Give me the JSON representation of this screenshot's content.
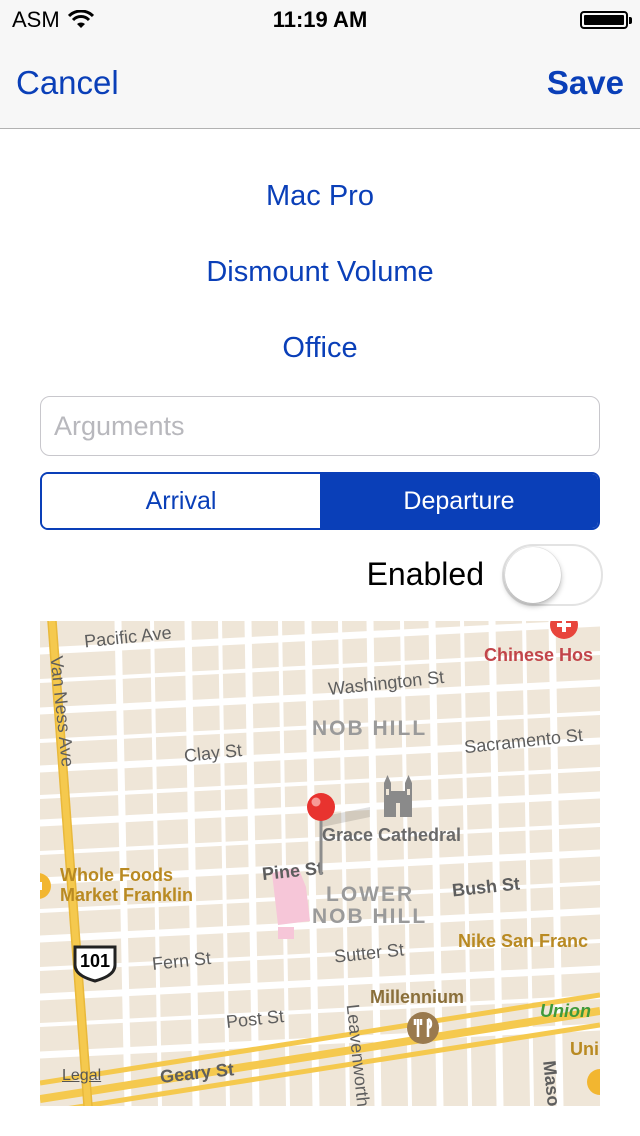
{
  "status_bar": {
    "carrier": "ASM",
    "time": "11:19 AM"
  },
  "nav": {
    "cancel_label": "Cancel",
    "save_label": "Save"
  },
  "actions": {
    "device": "Mac Pro",
    "action": "Dismount Volume",
    "location": "Office"
  },
  "arguments": {
    "value": "",
    "placeholder": "Arguments"
  },
  "trigger": {
    "options": [
      "Arrival",
      "Departure"
    ],
    "selected": "Departure"
  },
  "enabled": {
    "label": "Enabled",
    "on": false
  },
  "map": {
    "streets": [
      "Pacific Ave",
      "Van Ness Ave",
      "Washington St",
      "Clay St",
      "Sacramento St",
      "Pine St",
      "Bush St",
      "Sutter St",
      "Fern St",
      "Post St",
      "Geary St",
      "Leavenworth",
      "Maso"
    ],
    "districts": [
      "NOB HILL",
      "LOWER",
      "NOB HILL"
    ],
    "pois": [
      "Chinese Hos",
      "Grace Cathedral",
      "Whole Foods",
      "Market Franklin",
      "Nike San Franc",
      "Millennium",
      "Union",
      "Uni"
    ],
    "highway_shield": "101",
    "legal_label": "Legal",
    "colors": {
      "road": "#ffffff",
      "arterial": "#f5c94e",
      "block": "#efe6d8",
      "pin": "#e8332f"
    }
  }
}
